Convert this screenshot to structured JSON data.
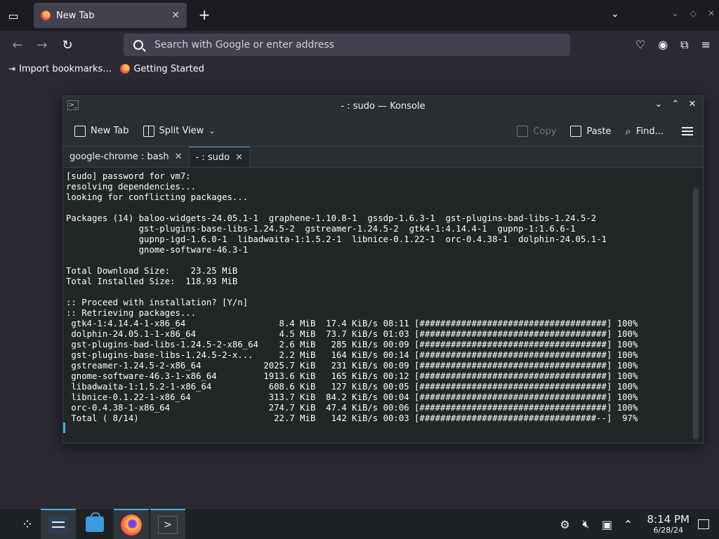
{
  "browser": {
    "tab": {
      "title": "New Tab"
    },
    "new_tab_symbol": "+",
    "urlbar": {
      "placeholder": "Search with Google or enter address"
    },
    "bookmarks": [
      {
        "label": "Import bookmarks…"
      },
      {
        "label": "Getting Started"
      }
    ]
  },
  "konsole": {
    "window_title": "- : sudo — Konsole",
    "toolbar": {
      "new_tab": "New Tab",
      "split_view": "Split View",
      "copy": "Copy",
      "paste": "Paste",
      "find": "Find..."
    },
    "tabs": [
      {
        "label": "google-chrome : bash",
        "active": false
      },
      {
        "label": "- : sudo",
        "active": true
      }
    ],
    "terminal_lines": [
      "[sudo] password for vm7:",
      "resolving dependencies...",
      "looking for conflicting packages...",
      "",
      "Packages (14) baloo-widgets-24.05.1-1  graphene-1.10.8-1  gssdp-1.6.3-1  gst-plugins-bad-libs-1.24.5-2",
      "              gst-plugins-base-libs-1.24.5-2  gstreamer-1.24.5-2  gtk4-1:4.14.4-1  gupnp-1:1.6.6-1",
      "              gupnp-igd-1.6.0-1  libadwaita-1:1.5.2-1  libnice-0.1.22-1  orc-0.4.38-1  dolphin-24.05.1-1",
      "              gnome-software-46.3-1",
      "",
      "Total Download Size:    23.25 MiB",
      "Total Installed Size:  118.93 MiB",
      "",
      ":: Proceed with installation? [Y/n]",
      ":: Retrieving packages...",
      " gtk4-1:4.14.4-1-x86_64                  8.4 MiB  17.4 KiB/s 08:11 [####################################] 100%",
      " dolphin-24.05.1-1-x86_64                4.5 MiB  73.7 KiB/s 01:03 [####################################] 100%",
      " gst-plugins-bad-libs-1.24.5-2-x86_64    2.6 MiB   285 KiB/s 00:09 [####################################] 100%",
      " gst-plugins-base-libs-1.24.5-2-x...     2.2 MiB   164 KiB/s 00:14 [####################################] 100%",
      " gstreamer-1.24.5-2-x86_64            2025.7 KiB   231 KiB/s 00:09 [####################################] 100%",
      " gnome-software-46.3-1-x86_64         1913.6 KiB   165 KiB/s 00:12 [####################################] 100%",
      " libadwaita-1:1.5.2-1-x86_64           608.6 KiB   127 KiB/s 00:05 [####################################] 100%",
      " libnice-0.1.22-1-x86_64               313.7 KiB  84.2 KiB/s 00:04 [####################################] 100%",
      " orc-0.4.38-1-x86_64                   274.7 KiB  47.4 KiB/s 00:06 [####################################] 100%",
      " Total ( 8/14)                          22.7 MiB   142 KiB/s 00:03 [##################################--]  97%"
    ]
  },
  "taskbar": {
    "time": "8:14 PM",
    "date": "6/28/24"
  },
  "colors": {
    "accent": "#3daee9",
    "terminal_bg": "#232627",
    "browser_bg": "#2b2a33"
  }
}
